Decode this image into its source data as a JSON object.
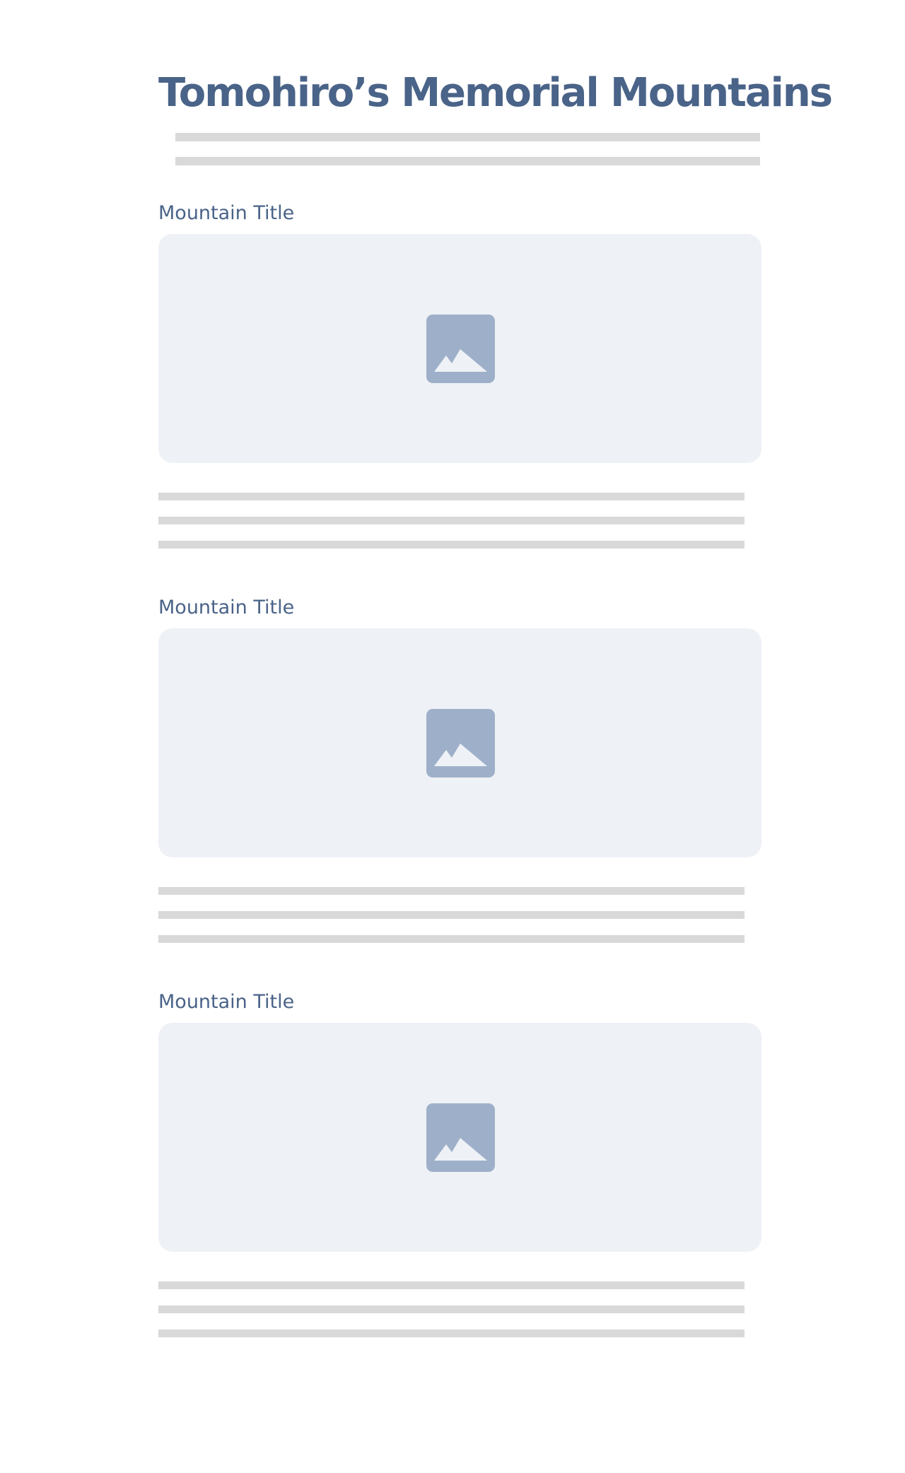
{
  "header": {
    "title": "Tomohiro’s Memorial Mountains"
  },
  "intro": {
    "placeholder_lines": 2
  },
  "sections": [
    {
      "title": "Mountain Title",
      "image_icon": "image-placeholder-icon",
      "placeholder_lines": 3
    },
    {
      "title": "Mountain Title",
      "image_icon": "image-placeholder-icon",
      "placeholder_lines": 3
    },
    {
      "title": "Mountain Title",
      "image_icon": "image-placeholder-icon",
      "placeholder_lines": 3
    }
  ],
  "colors": {
    "heading": "#4a6388",
    "image_background": "#eef1f6",
    "image_icon": "#9eb0c9",
    "placeholder_line": "#d9d9d9",
    "page_background": "#ffffff"
  }
}
